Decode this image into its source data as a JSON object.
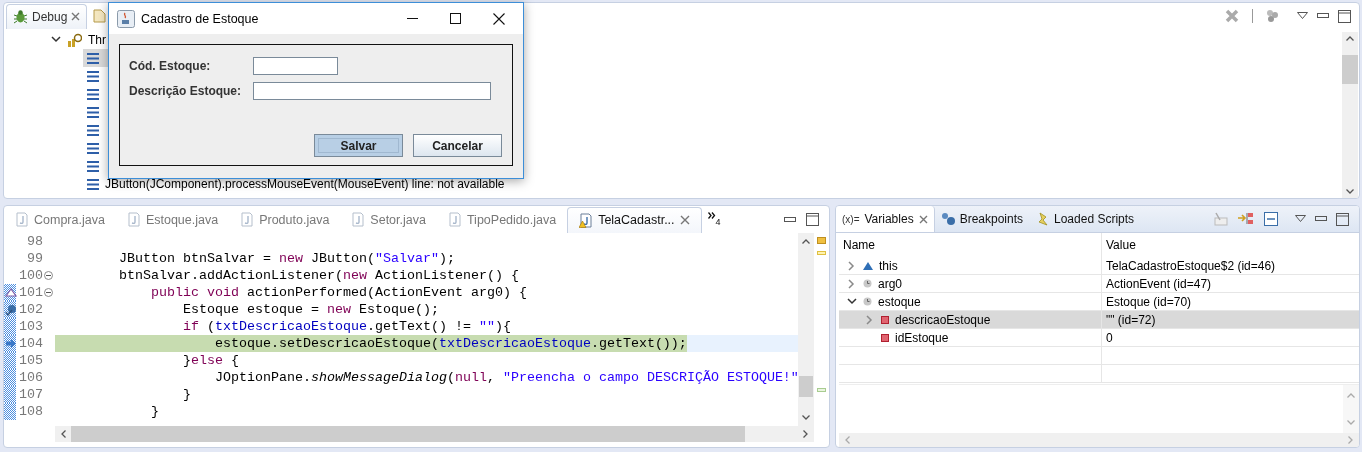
{
  "debug_view": {
    "tabs": [
      {
        "label": "Debug",
        "selected": true
      },
      {
        "selected": false
      }
    ],
    "tree": {
      "label": "Thr",
      "expanded": true
    },
    "stack_frames": [
      {
        "selected": true
      },
      {
        "selected": false
      },
      {
        "selected": false
      },
      {
        "selected": false
      },
      {
        "selected": false
      },
      {
        "selected": false
      },
      {
        "selected": false
      },
      {
        "label": "JButton(JComponent).processMouseEvent(MouseEvent) line: not available",
        "selected": false
      }
    ]
  },
  "dialog": {
    "title": "Cadastro de Estoque",
    "fields": [
      {
        "label": "Cód. Estoque:",
        "kind": "short"
      },
      {
        "label": "Descrição Estoque:",
        "kind": "long"
      }
    ],
    "buttons": [
      {
        "label": "Salvar",
        "focused": true
      },
      {
        "label": "Cancelar",
        "focused": false
      }
    ]
  },
  "editor": {
    "tabs": [
      {
        "label": "Compra.java",
        "selected": false,
        "warning": false
      },
      {
        "label": "Estoque.java",
        "selected": false,
        "warning": false
      },
      {
        "label": "Produto.java",
        "selected": false,
        "warning": false
      },
      {
        "label": "Setor.java",
        "selected": false,
        "warning": false
      },
      {
        "label": "TipoPedido.java",
        "selected": false,
        "warning": false
      },
      {
        "label": "TelaCadastr...",
        "selected": true,
        "warning": true
      }
    ],
    "overflow_count": "4",
    "lines": [
      {
        "number": "98",
        "fold": false,
        "in_range": false,
        "current": false,
        "method_entry": false,
        "breakpoint": false,
        "instruction_pointer": false
      },
      {
        "number": "99",
        "fold": false,
        "in_range": false,
        "current": false,
        "method_entry": false,
        "breakpoint": false,
        "instruction_pointer": false,
        "tokens": [
          {
            "kind": "plain",
            "text": "        JButton btnSalvar = "
          },
          {
            "kind": "keyword",
            "text": "new"
          },
          {
            "kind": "plain",
            "text": " JButton("
          },
          {
            "kind": "string",
            "text": "\"Salvar\""
          },
          {
            "kind": "plain",
            "text": ");"
          }
        ]
      },
      {
        "number": "100",
        "fold": true,
        "in_range": false,
        "current": false,
        "method_entry": false,
        "breakpoint": false,
        "instruction_pointer": false,
        "tokens": [
          {
            "kind": "plain",
            "text": "        btnSalvar.addActionListener("
          },
          {
            "kind": "keyword",
            "text": "new"
          },
          {
            "kind": "plain",
            "text": " ActionListener() {"
          }
        ]
      },
      {
        "number": "101",
        "fold": true,
        "in_range": true,
        "current": false,
        "method_entry": true,
        "breakpoint": false,
        "instruction_pointer": false,
        "tokens": [
          {
            "kind": "keyword",
            "text": "            public void"
          },
          {
            "kind": "plain",
            "text": " actionPerformed(ActionEvent arg0) {"
          }
        ]
      },
      {
        "number": "102",
        "fold": false,
        "in_range": true,
        "current": false,
        "method_entry": false,
        "breakpoint": true,
        "instruction_pointer": false,
        "tokens": [
          {
            "kind": "plain",
            "text": "                Estoque estoque = "
          },
          {
            "kind": "keyword",
            "text": "new"
          },
          {
            "kind": "plain",
            "text": " Estoque();"
          }
        ]
      },
      {
        "number": "103",
        "fold": false,
        "in_range": true,
        "current": false,
        "method_entry": false,
        "breakpoint": false,
        "instruction_pointer": false,
        "tokens": [
          {
            "kind": "keyword",
            "text": "                if"
          },
          {
            "kind": "plain",
            "text": " ("
          },
          {
            "kind": "field",
            "text": "txtDescricaoEstoque"
          },
          {
            "kind": "plain",
            "text": ".getText() != "
          },
          {
            "kind": "string",
            "text": "\"\""
          },
          {
            "kind": "plain",
            "text": "){"
          }
        ]
      },
      {
        "number": "104",
        "fold": false,
        "in_range": true,
        "current": true,
        "method_entry": false,
        "breakpoint": false,
        "instruction_pointer": true,
        "tokens": [
          {
            "kind": "plain",
            "text": "                    estoque.setDescricaoEstoque("
          },
          {
            "kind": "field",
            "text": "txtDescricaoEstoque"
          },
          {
            "kind": "plain",
            "text": ".getText());"
          }
        ]
      },
      {
        "number": "105",
        "fold": false,
        "in_range": true,
        "current": false,
        "method_entry": false,
        "breakpoint": false,
        "instruction_pointer": false,
        "tokens": [
          {
            "kind": "plain",
            "text": "                }"
          },
          {
            "kind": "keyword",
            "text": "else"
          },
          {
            "kind": "plain",
            "text": " {"
          }
        ]
      },
      {
        "number": "106",
        "fold": false,
        "in_range": true,
        "current": false,
        "method_entry": false,
        "breakpoint": false,
        "instruction_pointer": false,
        "tokens": [
          {
            "kind": "plain",
            "text": "                    JOptionPane."
          },
          {
            "kind": "static",
            "text": "showMessageDialog"
          },
          {
            "kind": "plain",
            "text": "("
          },
          {
            "kind": "keyword",
            "text": "null"
          },
          {
            "kind": "plain",
            "text": ", "
          },
          {
            "kind": "string",
            "text": "\"Preencha o campo DESCRIÇÃO ESTOQUE!\""
          }
        ]
      },
      {
        "number": "107",
        "fold": false,
        "in_range": true,
        "current": false,
        "method_entry": false,
        "breakpoint": false,
        "instruction_pointer": false,
        "tokens": [
          {
            "kind": "plain",
            "text": "                }"
          }
        ]
      },
      {
        "number": "108",
        "fold": false,
        "in_range": true,
        "current": false,
        "method_entry": false,
        "breakpoint": false,
        "instruction_pointer": false,
        "tokens": [
          {
            "kind": "plain",
            "text": "            }"
          }
        ]
      }
    ]
  },
  "variables_view": {
    "tabs": [
      {
        "label": "Variables",
        "icon_text": "(x)=",
        "kind": "variables",
        "selected": true
      },
      {
        "label": "Breakpoints",
        "kind": "breakpoints",
        "selected": false
      },
      {
        "label": "Loaded Scripts",
        "kind": "scripts",
        "selected": false
      }
    ],
    "columns": [
      "Name",
      "Value"
    ],
    "rows": [
      {
        "name": "this",
        "value": "TelaCadastroEstoque$2  (id=46)",
        "kind": "default",
        "expanded": false,
        "selected": false
      },
      {
        "name": "arg0",
        "value": "ActionEvent  (id=47)",
        "kind": "local",
        "expanded": false,
        "selected": false
      },
      {
        "name": "estoque",
        "value": "Estoque  (id=70)",
        "kind": "local",
        "expanded": true,
        "selected": false,
        "children": [
          {
            "name": "descricaoEstoque",
            "value": "\"\" (id=72)",
            "kind": "private",
            "expanded": false,
            "selected": true
          },
          {
            "name": "idEstoque",
            "value": "0",
            "kind": "private",
            "selected": false
          }
        ]
      }
    ]
  }
}
